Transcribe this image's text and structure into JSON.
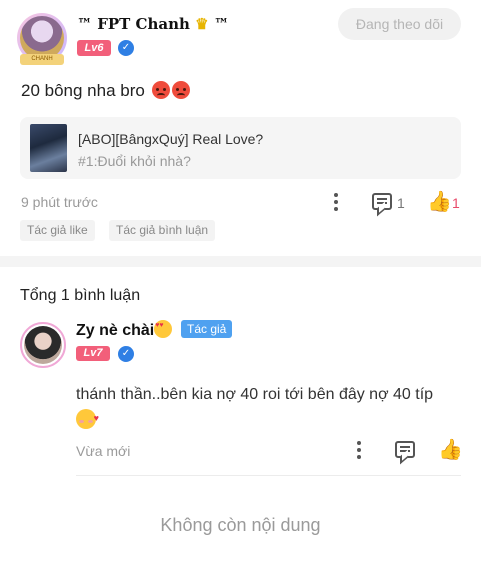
{
  "post": {
    "username": "™ FPT Chanh",
    "username_suffix": "™",
    "avatar_tag": "CHANH",
    "level": "Lv6",
    "follow_label": "Đang theo dõi",
    "content": "20 bông nha bro",
    "story": {
      "title": "[ABO][BângxQuý] Real Love?",
      "chapter": "#1:Đuổi khỏi nhà?"
    },
    "time": "9 phút trước",
    "comment_count": "1",
    "like_count": "1",
    "tags": [
      "Tác giả like",
      "Tác giả bình luận"
    ]
  },
  "comments": {
    "total_label": "Tổng 1 bình luận",
    "items": [
      {
        "username": "Zy nè chài",
        "author_tag": "Tác giả",
        "level": "Lv7",
        "text": "thánh thần..bên kia nợ 40 roi tới bên đây nợ 40 típ",
        "time": "Vừa mới"
      }
    ]
  },
  "footer": {
    "end_label": "Không còn nội dung"
  },
  "icons": {
    "verify": "verified-icon",
    "more": "more-vertical-icon",
    "comment": "comment-icon",
    "like": "thumbs-up-icon"
  },
  "colors": {
    "level_badge": "#f25f7a",
    "verified": "#2f7fe4",
    "liked": "#e84a6a",
    "author_tag": "#4fa1f0"
  }
}
